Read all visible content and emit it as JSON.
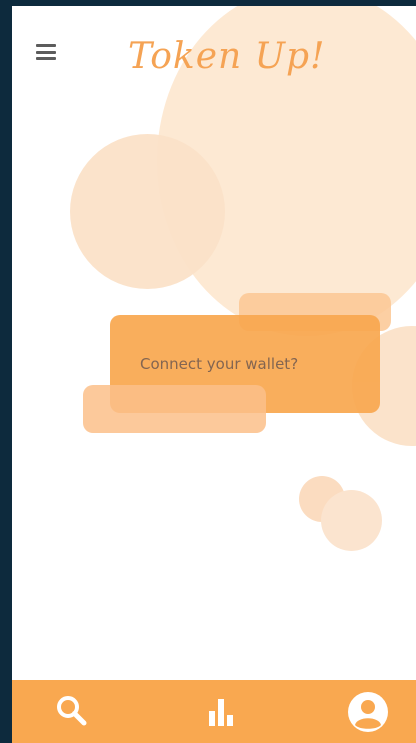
{
  "header": {
    "title": "Token Up!",
    "menu_icon": "hamburger-menu-icon"
  },
  "main": {
    "card_text": "Connect your wallet?"
  },
  "bottom_nav": {
    "items": [
      {
        "icon": "search-icon"
      },
      {
        "icon": "bar-chart-icon"
      },
      {
        "icon": "user-profile-icon"
      }
    ]
  },
  "colors": {
    "accent": "#f9a850",
    "title": "#f5a354",
    "background": "#ffffff",
    "frame": "#0d2a3d"
  }
}
